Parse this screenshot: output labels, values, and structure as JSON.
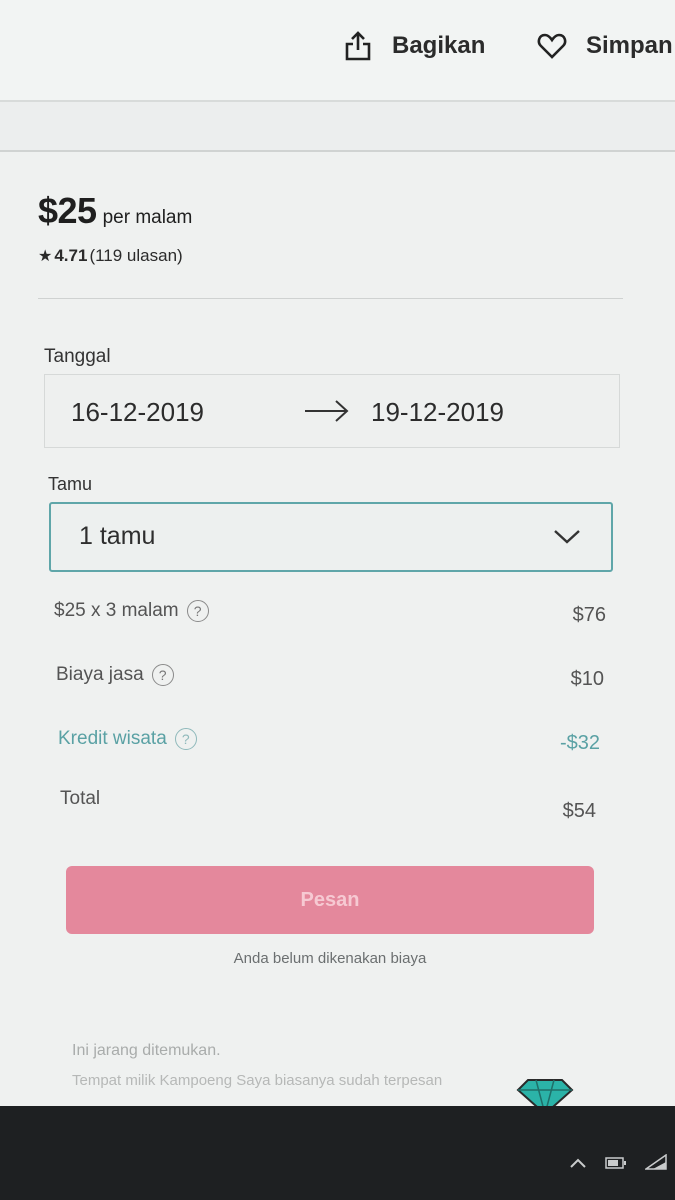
{
  "header": {
    "share_label": "Bagikan",
    "save_label": "Simpan"
  },
  "listing": {
    "price": "$25",
    "price_unit": "per malam",
    "rating_score": "4.71",
    "rating_reviews": "(119 ulasan)"
  },
  "booking": {
    "date_label": "Tanggal",
    "check_in": "16-12-2019",
    "check_out": "19-12-2019",
    "guest_label": "Tamu",
    "guest_value": "1 tamu"
  },
  "breakdown": [
    {
      "label": "$25 x 3 malam",
      "value": "$76"
    },
    {
      "label": "Biaya jasa",
      "value": "$10"
    },
    {
      "label": "Kredit wisata",
      "value": "-$32"
    },
    {
      "label": "Total",
      "value": "$54"
    }
  ],
  "book_button_label": "Pesan",
  "charge_note": "Anda belum dikenakan biaya",
  "rare": {
    "title": "Ini jarang ditemukan.",
    "desc": "Tempat milik Kampoeng Saya biasanya sudah terpesan"
  },
  "colors": {
    "accent_teal": "#5fa6a9",
    "button_pink": "#e4889c",
    "taskbar": "#1e2022"
  },
  "icons": {
    "share": "share-icon",
    "save": "heart-icon",
    "arrow": "arrow-right-icon",
    "chevron": "chevron-down-icon",
    "help": "question-circle-icon",
    "gem": "diamond-icon"
  }
}
